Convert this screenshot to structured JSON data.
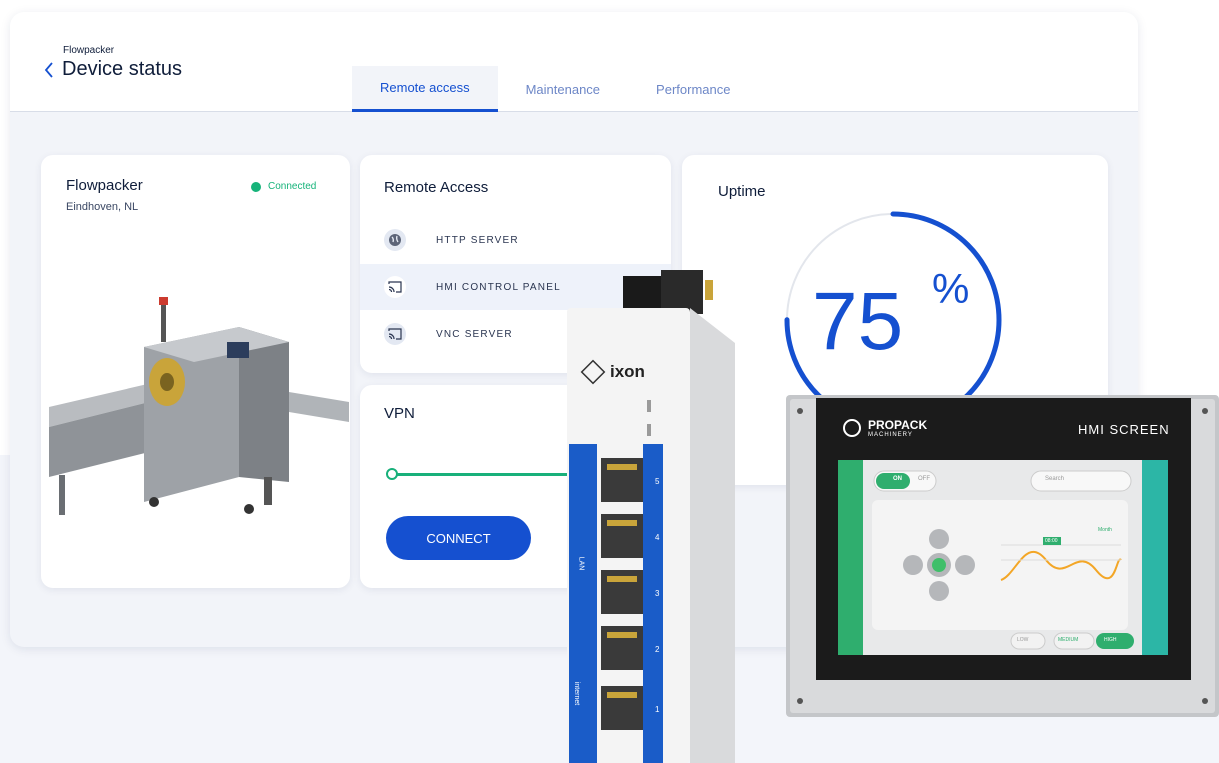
{
  "header": {
    "breadcrumb": "Flowpacker",
    "title": "Device status",
    "tabs": [
      {
        "label": "Remote access",
        "active": true
      },
      {
        "label": "Maintenance",
        "active": false
      },
      {
        "label": "Performance",
        "active": false
      }
    ]
  },
  "device": {
    "name": "Flowpacker",
    "location": "Eindhoven, NL",
    "status": "Connected",
    "status_color": "#16b37a"
  },
  "remote_access": {
    "title": "Remote Access",
    "items": [
      {
        "label": "HTTP SERVER",
        "icon": "globe-icon"
      },
      {
        "label": "HMI CONTROL PANEL",
        "icon": "cast-icon",
        "highlighted": true
      },
      {
        "label": "VNC SERVER",
        "icon": "cast-icon"
      }
    ]
  },
  "vpn": {
    "title": "VPN",
    "button": "CONNECT"
  },
  "uptime": {
    "title": "Uptime",
    "value": "75",
    "unit": "%",
    "fraction": 0.75
  },
  "gateway": {
    "brand": "ixon",
    "lan_label": "LAN",
    "wan_label": "internet",
    "ports": [
      "5",
      "4",
      "3",
      "2",
      "1"
    ]
  },
  "hmi": {
    "brand": "PROPACK",
    "brand_sub": "MACHINERY",
    "title": "HMI SCREEN",
    "toggle_on": "ON",
    "toggle_off": "OFF",
    "search_placeholder": "Search",
    "chart_label": "Month",
    "chart_badge": "08:00",
    "speed_buttons": [
      "LOW",
      "MEDIUM",
      "HIGH"
    ]
  },
  "colors": {
    "accent": "#1550d0",
    "success": "#16b37a"
  }
}
